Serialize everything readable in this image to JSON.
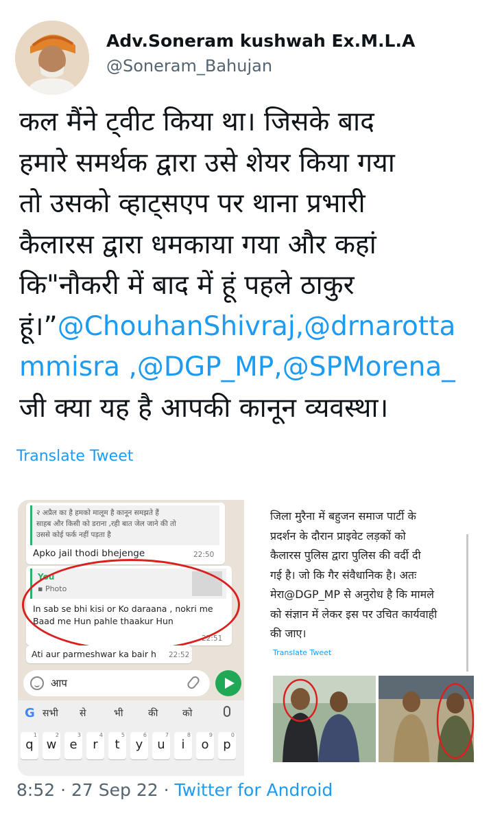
{
  "author": {
    "name": "Adv.Soneram kushwah Ex.M.L.A",
    "handle": "@Soneram_Bahujan"
  },
  "tweet": {
    "lines": [
      "कल मैंने ट्वीट किया था। जिसके बाद",
      "हमारे समर्थक द्वारा उसे शेयर किया गया",
      "तो उसको व्हाट्सएप पर थाना प्रभारी",
      "कैलारस द्वारा धमकाया गया और कहां",
      "कि\"नौकरी में बाद में हूं पहले ठाकुर"
    ],
    "line6_prefix": "हूं।”",
    "mention1": "@ChouhanShivraj,@drnarotta",
    "mention2": "mmisra ,@DGP_MP,@SPMorena_",
    "last_line": "जी क्या यह है आपकी कानून व्यवस्था।",
    "translate_label": "Translate Tweet"
  },
  "whatsapp": {
    "quoted_lines": [
      "२ अप्रैल का है हमको मालूम है कानून समझते हैं",
      "साहब और किसी को डराना ,रही बात जेल जाने की तो",
      "उससे कोई फर्क नहीं पड़ता है"
    ],
    "message1": "Apko jail thodi bhejenge",
    "message1_time": "22:50",
    "reply_label": "You",
    "photo_label": "Photo",
    "reply_text": "In sab se bhi kisi or Ko daraana , nokri me Baad me Hun pahle thaakur Hun",
    "reply_time": "22:51",
    "message3": "Ati aur parmeshwar ka bair h",
    "message3_time": "22:52",
    "input_text": "आप",
    "suggestions": [
      "सभी",
      "से",
      "भी",
      "की",
      "को"
    ],
    "keys": [
      {
        "key": "q",
        "num": "1"
      },
      {
        "key": "w",
        "num": "2"
      },
      {
        "key": "e",
        "num": "3"
      },
      {
        "key": "r",
        "num": "4"
      },
      {
        "key": "t",
        "num": "5"
      },
      {
        "key": "y",
        "num": "6"
      },
      {
        "key": "u",
        "num": "7"
      },
      {
        "key": "i",
        "num": "8"
      },
      {
        "key": "o",
        "num": "9"
      },
      {
        "key": "p",
        "num": "0"
      }
    ]
  },
  "right_post": {
    "lines": [
      "जिला मुरैना में बहुजन समाज पार्टी के",
      "प्रदर्शन के दौरान प्राइवेट लड़कों को",
      "कैलारस पुलिस द्वारा पुलिस की वर्दी दी",
      "गई है। जो कि गैर संवैधानिक है। अतः",
      "मेरा@DGP_MP से अनुरोध है कि मामले",
      "को संज्ञान में लेकर इस पर उचित कार्यवाही",
      "की जाए।"
    ],
    "translate_label": "Translate Tweet"
  },
  "meta": {
    "time": "8:52",
    "date": "27 Sep 22",
    "separator": "·",
    "app": "Twitter for Android"
  },
  "colors": {
    "link": "#1d9bf0",
    "text": "#0f1419",
    "secondary": "#536471",
    "whatsapp_green": "#1fa855",
    "highlight_red": "#d9201f"
  }
}
